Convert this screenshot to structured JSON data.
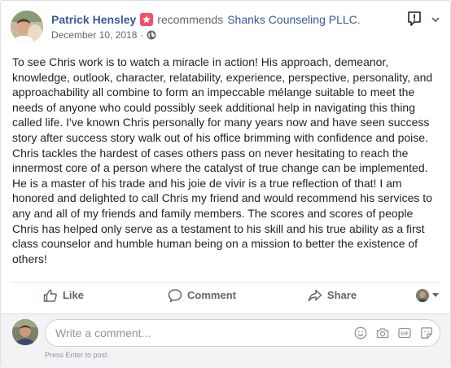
{
  "post": {
    "author": "Patrick Hensley",
    "verb": "recommends",
    "page": "Shanks Counseling PLLC.",
    "date": "December 10, 2018",
    "separator": "·",
    "text": "To see Chris work is to watch a miracle in action! His approach, demeanor, knowledge, outlook, character, relatability, experience, perspective, personality, and approachability all combine to form an impeccable mélange suitable to meet the needs of anyone who could possibly seek additional help in navigating this thing called life. I've known Chris personally for many years now and have seen success story after success story walk out of his office brimming with confidence and poise. Chris tackles the hardest of cases others pass on never hesitating to reach the innermost core of a person where the catalyst of true change can be implemented. He is a master of his trade and his joie de vivir is a true reflection of that! I am honored and delighted to call Chris my friend and would recommend his services to any and all of my friends and family members. The scores and scores of people Chris has helped only serve as a testament to his skill and his true ability as a first class counselor and humble human being on a mission to better the existence of others!"
  },
  "actions": {
    "like": "Like",
    "comment": "Comment",
    "share": "Share"
  },
  "comment_box": {
    "placeholder": "Write a comment...",
    "hint": "Press Enter to post."
  },
  "icons": {
    "recommend": "star-icon",
    "audience": "globe-icon",
    "report": "report-icon",
    "like": "thumbs-up-icon",
    "comment": "comment-bubble-icon",
    "share": "share-arrow-icon",
    "emoji": "emoji-icon",
    "camera": "camera-icon",
    "gif": "gif-icon",
    "sticker": "sticker-icon"
  },
  "colors": {
    "link": "#365899",
    "recommend_badge": "#f25268",
    "muted": "#616770"
  }
}
